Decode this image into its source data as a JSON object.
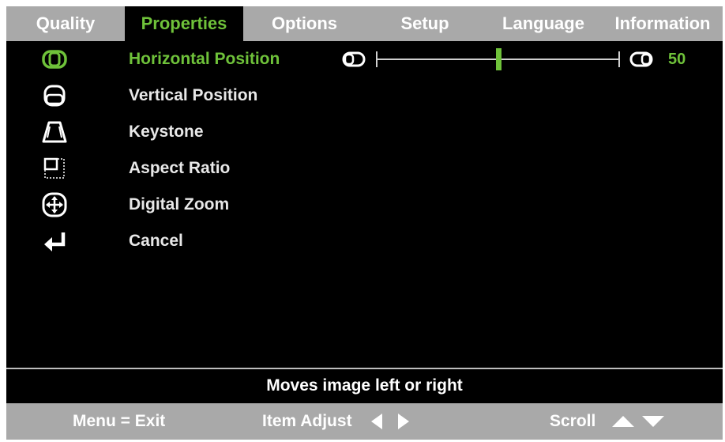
{
  "tabs": [
    {
      "label": "Quality",
      "active": false
    },
    {
      "label": "Properties",
      "active": true
    },
    {
      "label": "Options",
      "active": false
    },
    {
      "label": "Setup",
      "active": false
    },
    {
      "label": "Language",
      "active": false
    },
    {
      "label": "Information",
      "active": false
    }
  ],
  "menu": [
    {
      "label": "Horizontal Position",
      "icon": "horizontal-position-icon",
      "active": true
    },
    {
      "label": "Vertical Position",
      "icon": "vertical-position-icon",
      "active": false
    },
    {
      "label": "Keystone",
      "icon": "keystone-icon",
      "active": false
    },
    {
      "label": "Aspect Ratio",
      "icon": "aspect-ratio-icon",
      "active": false
    },
    {
      "label": "Digital Zoom",
      "icon": "digital-zoom-icon",
      "active": false
    },
    {
      "label": "Cancel",
      "icon": "return-arrow-icon",
      "active": false
    }
  ],
  "slider": {
    "value": "50",
    "fraction": 0.5
  },
  "help_text": "Moves image left or right",
  "footer": {
    "menu_exit": "Menu = Exit",
    "item_adjust": "Item Adjust",
    "scroll": "Scroll"
  },
  "colors": {
    "accent": "#6fc23a",
    "bar": "#a9a9a9",
    "background": "#000000",
    "text": "#e8e8e8"
  }
}
